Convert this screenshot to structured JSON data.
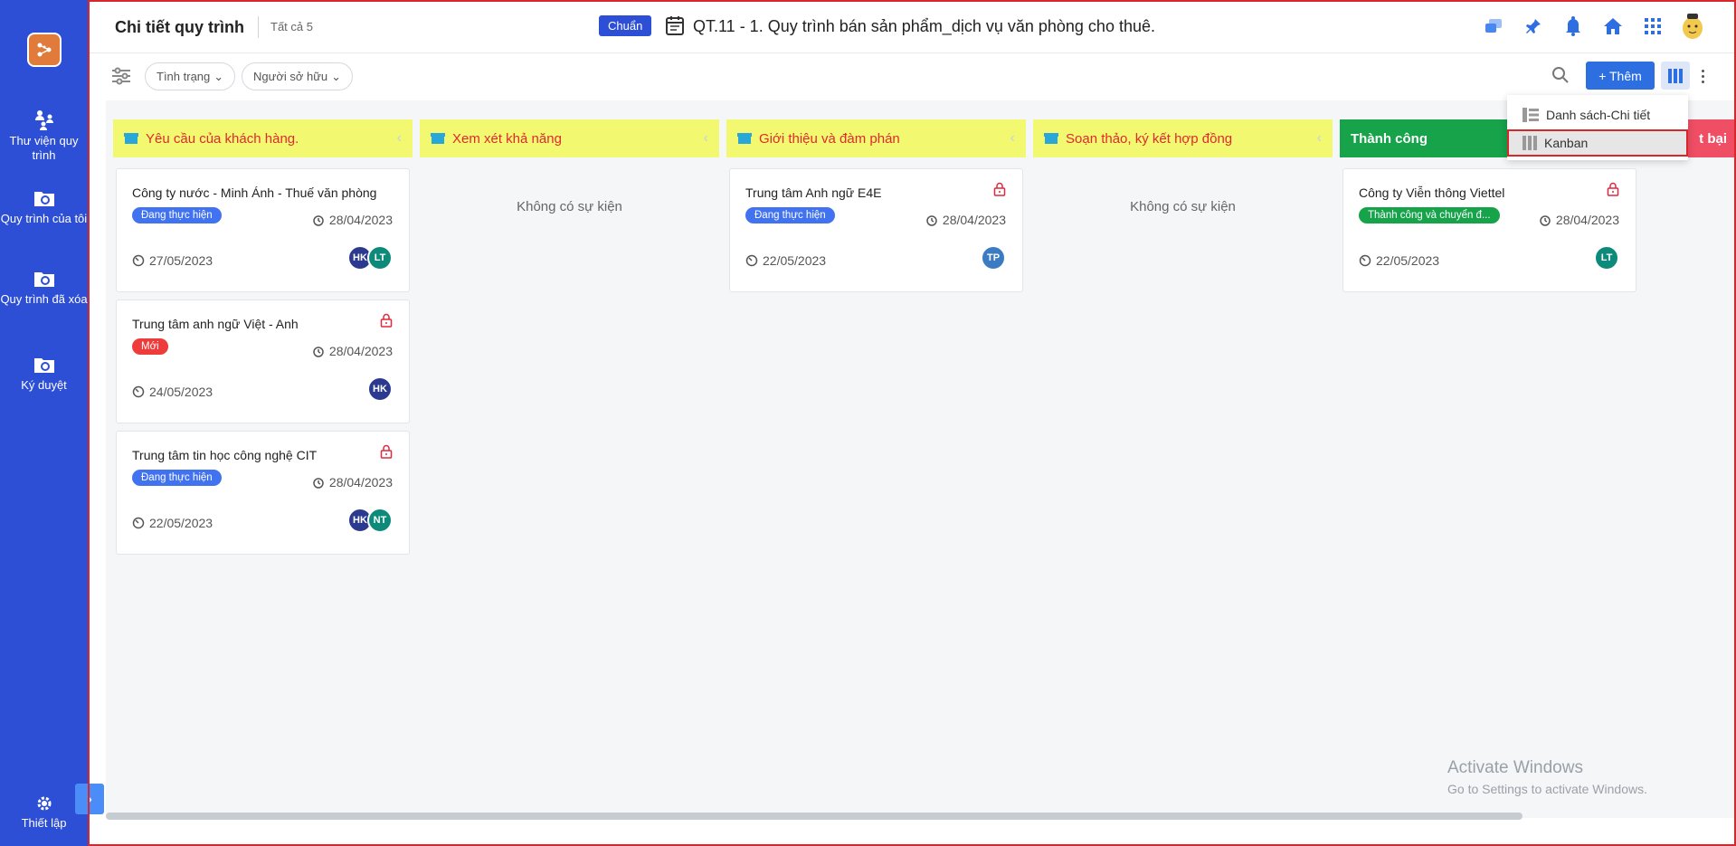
{
  "sidebar": {
    "items": [
      {
        "label": "Thư viện quy trình",
        "icon": "people-tree-icon"
      },
      {
        "label": "Quy trình của tôi",
        "icon": "folder-eye-icon"
      },
      {
        "label": "Quy trình đã xóa",
        "icon": "folder-delete-icon"
      },
      {
        "label": "Ký duyệt",
        "icon": "folder-sign-icon"
      }
    ],
    "settings_label": "Thiết lập"
  },
  "header": {
    "title": "Chi tiết quy trình",
    "count_label": "Tất cả 5",
    "badge": "Chuẩn",
    "process_title": "QT.11 - 1. Quy trình bán sản phẩm_dịch vụ văn phòng cho thuê."
  },
  "toolbar": {
    "status_filter": "Tình trạng",
    "owner_filter": "Người sở hữu",
    "add_label": "+ Thêm"
  },
  "view_menu": {
    "items": [
      {
        "label": "Danh sách-Chi tiết",
        "icon": "list-detail-icon"
      },
      {
        "label": "Kanban",
        "icon": "kanban-icon"
      }
    ],
    "selected": "Kanban"
  },
  "columns": [
    {
      "title": "Yêu cầu của khách hàng.",
      "cards": [
        {
          "title": "Công ty nước - Minh Ánh - Thuế văn phòng",
          "status": "Đang thực hiện",
          "due": "28/04/2023",
          "start": "27/05/2023",
          "avatars": [
            "HK",
            "LT"
          ],
          "locked": false
        },
        {
          "title": "Trung tâm anh ngữ Việt - Anh",
          "status": "Mới",
          "due": "28/04/2023",
          "start": "24/05/2023",
          "avatars": [
            "HK"
          ],
          "locked": true
        },
        {
          "title": "Trung tâm tin học công nghệ CIT",
          "status": "Đang thực hiện",
          "due": "28/04/2023",
          "start": "22/05/2023",
          "avatars": [
            "HK",
            "NT"
          ],
          "locked": true
        }
      ]
    },
    {
      "title": "Xem xét khả năng",
      "empty": "Không có sự kiện"
    },
    {
      "title": "Giới thiệu và đàm phán",
      "cards": [
        {
          "title": "Trung tâm Anh ngữ E4E",
          "status": "Đang thực hiện",
          "due": "28/04/2023",
          "start": "22/05/2023",
          "avatars": [
            "TP"
          ],
          "locked": true
        }
      ]
    },
    {
      "title": "Soạn thảo, ký kết hợp đồng",
      "empty": "Không có sự kiện"
    },
    {
      "title": "Thành công",
      "cards": [
        {
          "title": "Công ty Viễn thông Viettel",
          "status": "Thành công và chuyển đ...",
          "due": "28/04/2023",
          "start": "22/05/2023",
          "avatars": [
            "LT"
          ],
          "locked": true
        }
      ]
    },
    {
      "title": "t bại"
    }
  ],
  "watermark": {
    "line1": "Activate Windows",
    "line2": "Go to Settings to activate Windows."
  },
  "colors": {
    "sidebar": "#2d4fd6",
    "column_header": "#f2f970",
    "column_header_text": "#e0292f",
    "success": "#16a34a",
    "fail": "#ef4e64",
    "highlight_border": "#d9262c"
  }
}
